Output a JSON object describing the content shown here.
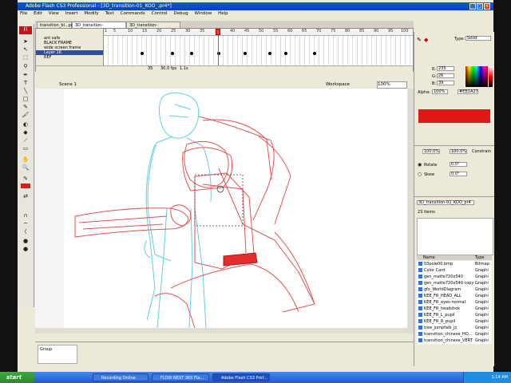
{
  "window": {
    "title": "Adobe Flash CS3 Professional - [3D_transition-01_KOO_.pr4*]"
  },
  "menu": [
    "File",
    "Edit",
    "View",
    "Insert",
    "Modify",
    "Text",
    "Commands",
    "Control",
    "Debug",
    "Window",
    "Help"
  ],
  "tools": {
    "logo": "Fl"
  },
  "doc_tabs": [
    "transition_bl...pr*",
    "3D_transition-01_KOO_pr4*",
    "3D_transition-01_KOO_ss3"
  ],
  "timeline": {
    "layers": [
      {
        "name": "ant safe"
      },
      {
        "name": "BLACK FRAME"
      },
      {
        "name": "wide screen frame"
      },
      {
        "name": "Layer 16"
      },
      {
        "name": "REF"
      }
    ],
    "ruler_ticks": [
      "1",
      "5",
      "10",
      "15",
      "20",
      "25",
      "30",
      "35",
      "40",
      "45",
      "50",
      "55",
      "60",
      "65",
      "70",
      "75",
      "80",
      "85",
      "90",
      "95",
      "100",
      "105"
    ],
    "status": [
      "35",
      "30.0 fps",
      "1.1s"
    ]
  },
  "stage": {
    "scene": "Scene 1",
    "workspace": "Workspace",
    "zoom": "100%"
  },
  "properties": {
    "label": "Group"
  },
  "color": {
    "type_label": "Type:",
    "type_value": "Solid",
    "r_label": "R:",
    "r": "235",
    "g_label": "G:",
    "g": "26",
    "b_label": "B:",
    "b": "39",
    "alpha_label": "Alpha:",
    "alpha": "100%",
    "hex": "#EB1A27",
    "swatch_color": "#e11818"
  },
  "transform": {
    "width": "100.0%",
    "height": "100.0%",
    "constrain": "Constrain",
    "rotate": "Rotate",
    "rotate_value": "0.0°",
    "skew": "Skew",
    "skew_value": "0.0°"
  },
  "library": {
    "doc": "3D_transition-01_KOO_pr4",
    "count": "23 items",
    "header_name": "Name",
    "header_type": "Type",
    "items": [
      {
        "name": "03pole00.bmp",
        "type": "Bitmap"
      },
      {
        "name": "Color Card",
        "type": "Graphi"
      },
      {
        "name": "gen_matte720x540",
        "type": "Graphi"
      },
      {
        "name": "gen_matte720x540 copy",
        "type": "Graphi"
      },
      {
        "name": "gfx_WorldDiagram",
        "type": "Graphi"
      },
      {
        "name": "KEE_FR_HEAD_ALL",
        "type": "Graphi"
      },
      {
        "name": "KEE_FR_eyes-normal",
        "type": "Graphi"
      },
      {
        "name": "KEE_FR_headshok",
        "type": "Graphi"
      },
      {
        "name": "KEE_FR_L_pupil",
        "type": "Graphi"
      },
      {
        "name": "KEE_FR_R_pupil",
        "type": "Graphi"
      },
      {
        "name": "tree_jumpfaib_jz",
        "type": "Graphi"
      },
      {
        "name": "transition_chinese_HO...",
        "type": "Graphi"
      },
      {
        "name": "transition_chinese_VERT",
        "type": "Graphi"
      }
    ]
  },
  "taskbar": {
    "start": "start",
    "tasks": [
      "Recording Online",
      "FLOW NEXT 365 Fla...",
      "Adobe Flash CS3 Prof..."
    ],
    "clock": "1:14 AM"
  }
}
